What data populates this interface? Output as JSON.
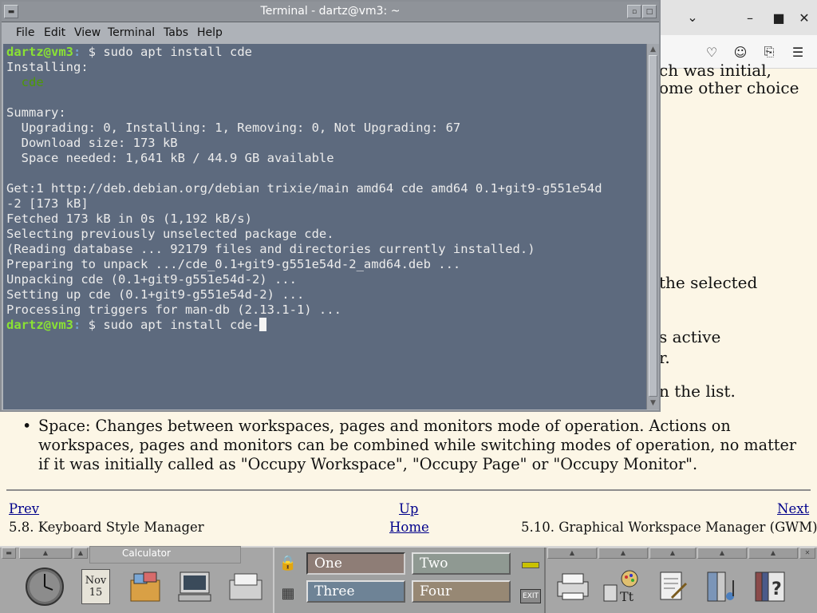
{
  "browser": {
    "window_controls": {
      "chevron": "chevron-down-icon",
      "minimize": "minimize-icon",
      "maximize": "maximize-icon",
      "close": "close-icon"
    },
    "toolbar_icons": [
      "pocket-icon",
      "account-icon",
      "extensions-icon",
      "hamburger-menu-icon"
    ]
  },
  "doc": {
    "frag1": "ch was initial,",
    "frag2": "ome other choice",
    "frag3": "the selected",
    "frag4": "s active",
    "frag5": "r.",
    "frag6": "n the list.",
    "space_bullet": "Space: Changes between workspaces, pages and monitors mode of operation. Actions on workspaces, pages and monitors can be combined while switching modes of operation, no matter if it was initially called as \"Occupy Workspace\", \"Occupy Page\" or \"Occupy Monitor\".",
    "nav": {
      "prev": "Prev",
      "up": "Up",
      "next": "Next",
      "prev_title": "5.8. Keyboard Style Manager",
      "home": "Home",
      "next_title": "5.10. Graphical Workspace Manager (GWM)"
    }
  },
  "terminal": {
    "title": "Terminal - dartz@vm3: ~",
    "menu": [
      "File",
      "Edit",
      "View",
      "Terminal",
      "Tabs",
      "Help"
    ],
    "prompt_user": "dartz@vm3",
    "prompt_path": ":",
    "prompt_sym": " $ ",
    "cmd1": "sudo apt install cde",
    "installing": "Installing:",
    "pkg": "  cde",
    "summary": "Summary:",
    "sum1": "  Upgrading: 0, Installing: 1, Removing: 0, Not Upgrading: 67",
    "sum2": "  Download size: 173 kB",
    "sum3": "  Space needed: 1,641 kB / 44.9 GB available",
    "get1a": "Get:1 http://deb.debian.org/debian trixie/main amd64 cde amd64 0.1+git9-g551e54d",
    "get1b": "-2 [173 kB]",
    "fetched": "Fetched 173 kB in 0s (1,192 kB/s)",
    "selecting": "Selecting previously unselected package cde.",
    "reading": "(Reading database ... 92179 files and directories currently installed.)",
    "preparing": "Preparing to unpack .../cde_0.1+git9-g551e54d-2_amd64.deb ...",
    "unpacking": "Unpacking cde (0.1+git9-g551e54d-2) ...",
    "setting": "Setting up cde (0.1+git9-g551e54d-2) ...",
    "processing": "Processing triggers for man-db (2.13.1-1) ...",
    "cmd2": "sudo apt install cde-"
  },
  "panel": {
    "calculator_label": "Calculator",
    "calendar_month": "Nov",
    "calendar_day": "15",
    "workspaces": [
      "One",
      "Two",
      "Three",
      "Four"
    ],
    "exit_label": "EXIT",
    "icons": [
      "clock-icon",
      "calendar-icon",
      "file-manager-icon",
      "terminal-icon",
      "mailer-icon",
      "lock-icon",
      "busy-light-icon",
      "exit-icon",
      "printer-icon",
      "style-manager-icon",
      "text-editor-icon",
      "app-manager-icon",
      "help-icon"
    ]
  },
  "colors": {
    "terminal_bg": "#5d6a7e",
    "prompt_user": "#8ae234",
    "prompt_path": "#729fcf",
    "document_bg": "#fcf6e6",
    "link": "#00008b"
  }
}
